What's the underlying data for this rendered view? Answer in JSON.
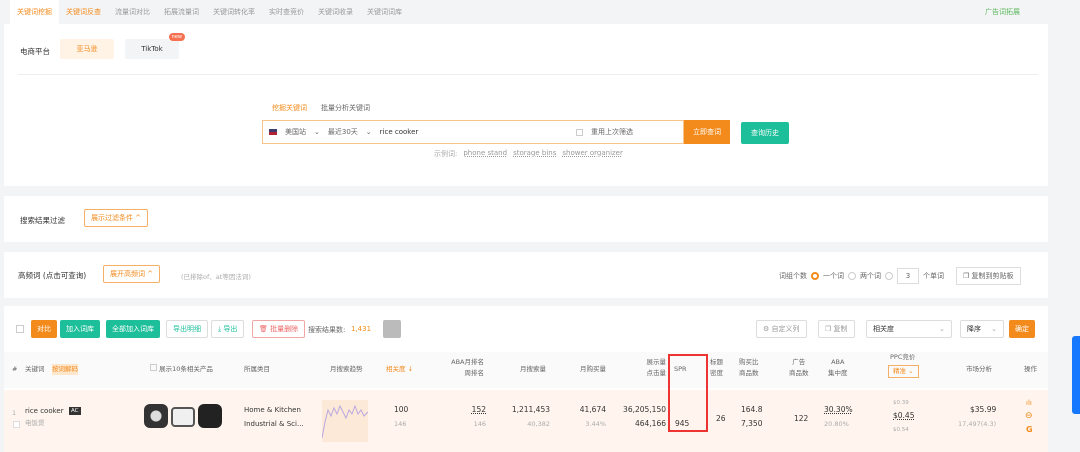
{
  "tabs": [
    "关键词挖掘",
    "关键词反查",
    "流量词对比",
    "拓展流量词",
    "关键词转化率",
    "实时查竞价",
    "关键词收录",
    "关键词词库"
  ],
  "tab_right": "广告词拓展",
  "platform": {
    "label": "电商平台",
    "amazon": "亚马逊",
    "tiktok": "TikTok",
    "new_badge": "new"
  },
  "search": {
    "tabs": [
      "挖掘关键词",
      "批量分析关键词"
    ],
    "site": "美国站",
    "period": "最近30天",
    "keyword": "rice cooker",
    "reuse": "重用上次筛选",
    "submit": "立即查词",
    "history": "查询历史",
    "examples_label": "示例词:",
    "examples": [
      "phone stand",
      "storage bins",
      "shower organizer"
    ]
  },
  "filter": {
    "label": "搜索结果过滤",
    "button": "展示过滤条件 ^"
  },
  "freq": {
    "label": "高频词 (点击可查询)",
    "button": "展开高频词 ^",
    "note": "(已排除of、at等因法词)",
    "word_count_label": "词组个数",
    "one": "一个词",
    "two": "两个词",
    "n": "3",
    "n_suffix": "个单词",
    "copy": "复制到剪贴板"
  },
  "toolbar": {
    "compare": "对比",
    "add": "加入词库",
    "add_all": "全部加入词库",
    "export_detail": "导出明细",
    "export": "导出",
    "batch_delete": "批量删除",
    "count_label": "搜索结果数:",
    "count": "1,431",
    "custom_cols": "自定义列",
    "copy": "复制",
    "sort_field": "相关度",
    "sort_order": "降序",
    "confirm": "确定"
  },
  "headers": {
    "idx": "#",
    "keyword": "关键词",
    "kw_tag": "按词解码",
    "show10": "展示10条相关产品",
    "category": "所属类目",
    "trend": "月搜索趋势",
    "relevance": "相关度 ↓",
    "aba1": "ABA月排名",
    "aba2": "周排名",
    "monthly_search": "月搜索量",
    "monthly_buy": "月购买量",
    "impr": "展示量",
    "clicks": "点击量",
    "spr": "SPR",
    "title1": "标题",
    "title2": "密度",
    "ratio1": "购买比",
    "ratio2": "商品数",
    "ad1": "广告",
    "ad2": "商品数",
    "abac1": "ABA",
    "abac2": "集中度",
    "ppc": "PPC竞价",
    "ppc_mode": "精准",
    "market": "市场分析",
    "ops": "操作"
  },
  "row": {
    "idx": "1",
    "keyword": "rice cooker",
    "tag": "AC",
    "translation": "电饭煲",
    "cat1": "Home & Kitchen",
    "cat2": "Industrial & Sci...",
    "relevance": "100",
    "relevance_sub": "146",
    "aba_month": "152",
    "aba_week": "146",
    "search": "1,211,453",
    "search_sub": "40,382",
    "buy": "41,674",
    "buy_rate": "3.44%",
    "impressions": "36,205,150",
    "clicks": "464,166",
    "spr": "945",
    "title_density": "26",
    "ratio": "164.8",
    "products": "7,350",
    "ad_products": "122",
    "aba_conc": "30.30%",
    "aba_conc_sub": "20.80%",
    "ppc_low": "$0.39",
    "ppc": "$0.45",
    "ppc_high": "$0.54",
    "price": "$35.99",
    "reviews": "17,497(4.3)"
  },
  "colors": {
    "accent": "#f38b1c",
    "green": "#1dbf9a",
    "highlight": "#e33333"
  }
}
